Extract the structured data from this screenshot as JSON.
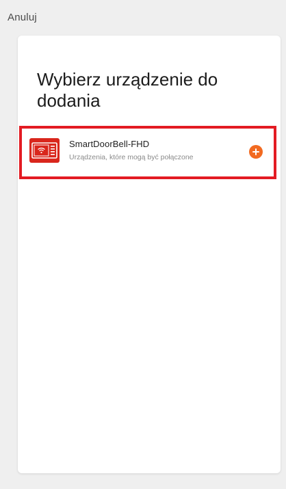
{
  "header": {
    "cancel_label": "Anuluj"
  },
  "dialog": {
    "title": "Wybierz urządzenie do dodania",
    "devices": [
      {
        "name": "SmartDoorBell-FHD",
        "subtitle": "Urządzenia, które mogą być połączone",
        "icon": "video-doorbell-monitor-icon",
        "action_icon": "add-circle-icon"
      }
    ]
  },
  "colors": {
    "background": "#efefef",
    "card": "#ffffff",
    "highlight_border": "#e31b23",
    "device_thumb": "#d9261c",
    "add_button": "#f26a21"
  }
}
